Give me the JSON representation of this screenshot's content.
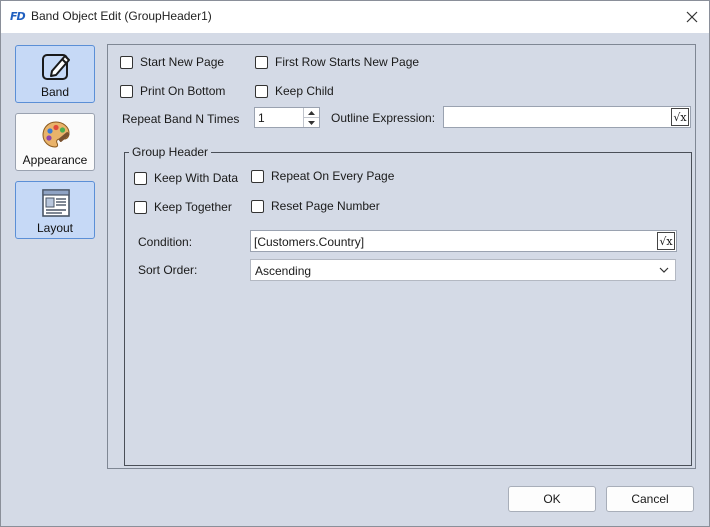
{
  "window": {
    "title": "Band Object Edit (GroupHeader1)",
    "logo": "FD",
    "close_icon": "close-icon"
  },
  "nav": {
    "items": [
      {
        "label": "Band",
        "icon": "pencil-note-icon",
        "active": true
      },
      {
        "label": "Appearance",
        "icon": "palette-icon",
        "active": false
      },
      {
        "label": "Layout",
        "icon": "layout-icon",
        "active": false
      }
    ]
  },
  "band": {
    "start_new_page": {
      "label": "Start New Page",
      "checked": false
    },
    "first_row_starts_new_page": {
      "label": "First Row Starts New Page",
      "checked": false
    },
    "print_on_bottom": {
      "label": "Print On Bottom",
      "checked": false
    },
    "keep_child": {
      "label": "Keep Child",
      "checked": false
    },
    "repeat_band_label": "Repeat Band N Times",
    "repeat_band_value": "1",
    "outline_expression_label": "Outline Expression:",
    "outline_expression_value": ""
  },
  "group_header": {
    "title": "Group Header",
    "keep_with_data": {
      "label": "Keep With Data",
      "checked": false
    },
    "repeat_on_every_page": {
      "label": "Repeat On Every Page",
      "checked": false
    },
    "keep_together": {
      "label": "Keep Together",
      "checked": false
    },
    "reset_page_number": {
      "label": "Reset Page Number",
      "checked": false
    },
    "condition_label": "Condition:",
    "condition_value": "[Customers.Country]",
    "sort_order_label": "Sort Order:",
    "sort_order_value": "Ascending"
  },
  "footer": {
    "ok_label": "OK",
    "cancel_label": "Cancel"
  },
  "colors": {
    "background": "#d4dae6",
    "nav_active_bg": "#c6d9f6",
    "nav_active_border": "#5b8fd6",
    "logo_blue": "#1f5fbf"
  }
}
